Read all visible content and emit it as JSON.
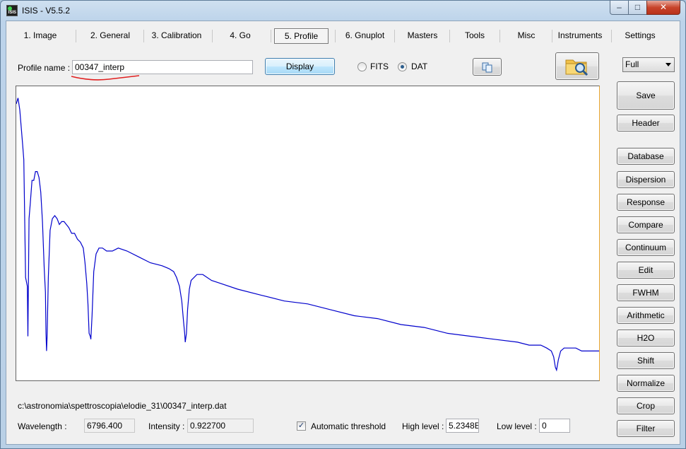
{
  "window": {
    "title": "ISIS - V5.5.2",
    "min_label": "–",
    "max_label": "□",
    "close_label": "✕"
  },
  "tabs": [
    {
      "label": "1. Image"
    },
    {
      "label": "2. General"
    },
    {
      "label": "3. Calibration"
    },
    {
      "label": "4. Go"
    },
    {
      "label": "5. Profile"
    },
    {
      "label": "6. Gnuplot"
    },
    {
      "label": "Masters"
    },
    {
      "label": "Tools"
    },
    {
      "label": "Misc"
    },
    {
      "label": "Instruments"
    },
    {
      "label": "Settings"
    }
  ],
  "active_tab": "5. Profile",
  "profile": {
    "name_label": "Profile name :",
    "name_value": "00347_interp",
    "display_button": "Display",
    "format_options": [
      "FITS",
      "DAT"
    ],
    "format_selected": "DAT"
  },
  "view_select": {
    "value": "Full"
  },
  "side_buttons": {
    "save": "Save",
    "header": "Header",
    "database": "Database",
    "dispersion": "Dispersion",
    "response": "Response",
    "compare": "Compare",
    "continuum": "Continuum",
    "edit": "Edit",
    "fwhm": "FWHM",
    "arithmetic": "Arithmetic",
    "h2o": "H2O",
    "shift": "Shift",
    "normalize": "Normalize",
    "crop": "Crop",
    "filter": "Filter"
  },
  "status": {
    "file_path": "c:\\astronomia\\spettroscopia\\elodie_31\\00347_interp.dat",
    "wavelength_label": "Wavelength :",
    "wavelength_value": "6796.400",
    "intensity_label": "Intensity :",
    "intensity_value": "0.922700",
    "auto_threshold_label": "Automatic threshold",
    "auto_threshold_checked": true,
    "high_level_label": "High level :",
    "high_level_value": "5.2348E",
    "low_level_label": "Low level :",
    "low_level_value": "0"
  },
  "colors": {
    "spectrum": "#0000cc",
    "annotation_underline": "#e02020"
  },
  "chart_data": {
    "type": "line",
    "title": "",
    "xlabel": "",
    "ylabel": "",
    "series": [
      {
        "points": [
          [
            0.0,
            0.06
          ],
          [
            0.003,
            0.04
          ],
          [
            0.006,
            0.08
          ],
          [
            0.009,
            0.15
          ],
          [
            0.011,
            0.2
          ],
          [
            0.013,
            0.25
          ],
          [
            0.016,
            0.65
          ],
          [
            0.019,
            0.68
          ],
          [
            0.02,
            0.85
          ],
          [
            0.022,
            0.45
          ],
          [
            0.024,
            0.4
          ],
          [
            0.027,
            0.32
          ],
          [
            0.03,
            0.32
          ],
          [
            0.033,
            0.29
          ],
          [
            0.036,
            0.29
          ],
          [
            0.039,
            0.31
          ],
          [
            0.042,
            0.36
          ],
          [
            0.045,
            0.46
          ],
          [
            0.048,
            0.62
          ],
          [
            0.05,
            0.7
          ],
          [
            0.051,
            0.84
          ],
          [
            0.052,
            0.9
          ],
          [
            0.053,
            0.85
          ],
          [
            0.055,
            0.65
          ],
          [
            0.058,
            0.49
          ],
          [
            0.062,
            0.45
          ],
          [
            0.066,
            0.44
          ],
          [
            0.07,
            0.45
          ],
          [
            0.074,
            0.47
          ],
          [
            0.078,
            0.46
          ],
          [
            0.082,
            0.46
          ],
          [
            0.086,
            0.47
          ],
          [
            0.09,
            0.48
          ],
          [
            0.095,
            0.5
          ],
          [
            0.1,
            0.5
          ],
          [
            0.105,
            0.52
          ],
          [
            0.11,
            0.53
          ],
          [
            0.115,
            0.55
          ],
          [
            0.118,
            0.6
          ],
          [
            0.121,
            0.67
          ],
          [
            0.123,
            0.74
          ],
          [
            0.125,
            0.84
          ],
          [
            0.127,
            0.85
          ],
          [
            0.128,
            0.86
          ],
          [
            0.13,
            0.78
          ],
          [
            0.133,
            0.63
          ],
          [
            0.137,
            0.57
          ],
          [
            0.142,
            0.55
          ],
          [
            0.148,
            0.55
          ],
          [
            0.155,
            0.56
          ],
          [
            0.165,
            0.56
          ],
          [
            0.175,
            0.55
          ],
          [
            0.19,
            0.56
          ],
          [
            0.21,
            0.58
          ],
          [
            0.23,
            0.6
          ],
          [
            0.25,
            0.61
          ],
          [
            0.262,
            0.62
          ],
          [
            0.27,
            0.63
          ],
          [
            0.275,
            0.65
          ],
          [
            0.28,
            0.68
          ],
          [
            0.284,
            0.73
          ],
          [
            0.287,
            0.8
          ],
          [
            0.289,
            0.84
          ],
          [
            0.29,
            0.87
          ],
          [
            0.292,
            0.84
          ],
          [
            0.294,
            0.76
          ],
          [
            0.297,
            0.69
          ],
          [
            0.3,
            0.66
          ],
          [
            0.305,
            0.65
          ],
          [
            0.31,
            0.64
          ],
          [
            0.32,
            0.64
          ],
          [
            0.335,
            0.66
          ],
          [
            0.35,
            0.67
          ],
          [
            0.38,
            0.69
          ],
          [
            0.42,
            0.71
          ],
          [
            0.46,
            0.73
          ],
          [
            0.5,
            0.74
          ],
          [
            0.54,
            0.76
          ],
          [
            0.58,
            0.78
          ],
          [
            0.62,
            0.79
          ],
          [
            0.66,
            0.81
          ],
          [
            0.7,
            0.82
          ],
          [
            0.74,
            0.84
          ],
          [
            0.78,
            0.85
          ],
          [
            0.82,
            0.86
          ],
          [
            0.86,
            0.87
          ],
          [
            0.88,
            0.88
          ],
          [
            0.9,
            0.88
          ],
          [
            0.91,
            0.89
          ],
          [
            0.918,
            0.9
          ],
          [
            0.922,
            0.92
          ],
          [
            0.925,
            0.955
          ],
          [
            0.927,
            0.965
          ],
          [
            0.93,
            0.93
          ],
          [
            0.934,
            0.9
          ],
          [
            0.94,
            0.89
          ],
          [
            0.95,
            0.89
          ],
          [
            0.96,
            0.89
          ],
          [
            0.97,
            0.9
          ],
          [
            0.985,
            0.9
          ],
          [
            1.0,
            0.9
          ]
        ]
      }
    ]
  }
}
